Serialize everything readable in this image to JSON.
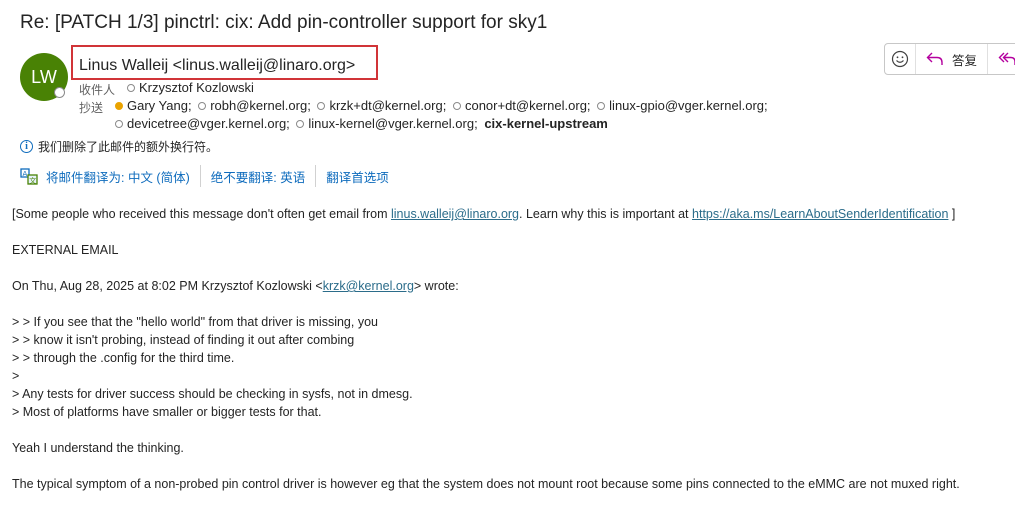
{
  "subject": "Re: [PATCH 1/3] pinctrl: cix: Add pin-controller support for sky1",
  "sender": {
    "initials": "LW",
    "display": "Linus Walleij <linus.walleij@linaro.org>"
  },
  "to_label": "收件人",
  "to": [
    "Krzysztof Kozlowski"
  ],
  "cc_label": "抄送",
  "cc_line1": [
    "Gary Yang;",
    "robh@kernel.org;",
    "krzk+dt@kernel.org;",
    "conor+dt@kernel.org;",
    "linux-gpio@vger.kernel.org;"
  ],
  "cc_line2": [
    "devicetree@vger.kernel.org;",
    "linux-kernel@vger.kernel.org;"
  ],
  "cc_group": "cix-kernel-upstream",
  "info_notice": "我们删除了此邮件的额外换行符。",
  "translate": {
    "translate_to": "将邮件翻译为: 中文 (简体)",
    "never_translate": "绝不要翻译: 英语",
    "preferences": "翻译首选项"
  },
  "toolbar": {
    "emoji_icon": "smiley-icon",
    "reply_label": "答复"
  },
  "body": {
    "warning_pre": "[Some people who received this message don't often get email from ",
    "warning_email": "linus.walleij@linaro.org",
    "warning_mid": ". Learn why this is important at ",
    "warning_link": "https://aka.ms/LearnAboutSenderIdentification",
    "warning_post": " ]",
    "external": "EXTERNAL EMAIL",
    "wrote_pre": "On Thu, Aug 28, 2025 at 8:02 PM Krzysztof Kozlowski <",
    "wrote_email": "krzk@kernel.org",
    "wrote_post": "> wrote:",
    "quote": [
      "> > If you see that the \"hello world\" from that driver is missing, you",
      "> > know it isn't probing, instead of finding it out after combing",
      "> > through the .config for the third time.",
      ">",
      "> Any tests for driver success should be checking in sysfs, not in dmesg.",
      "> Most of platforms have smaller or bigger tests for that."
    ],
    "reply1": "Yeah I understand the thinking.",
    "reply2": "The typical symptom of a non-probed pin control driver is however eg that the system does not mount root because some pins connected to the eMMC are not muxed right."
  }
}
